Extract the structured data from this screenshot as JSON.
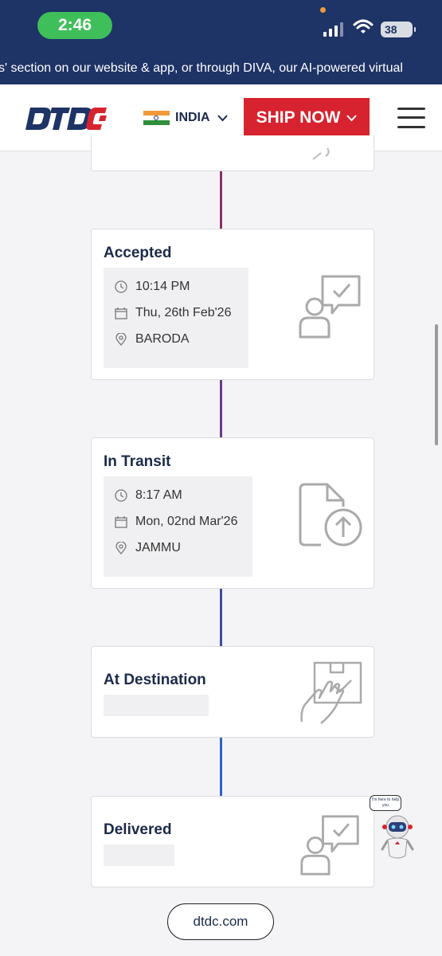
{
  "status_bar": {
    "time": "2:46",
    "battery": "38"
  },
  "announcement": "s' section on our website & app, or through DIVA, our AI-powered virtual",
  "header": {
    "logo_text": "DTDC",
    "country": "INDIA",
    "ship_now": "SHIP NOW",
    "colors": {
      "brand_red": "#d7232f",
      "brand_navy": "#1e3366"
    }
  },
  "timeline": [
    {
      "status": "Accepted",
      "time": "10:14 PM",
      "date": "Thu, 26th Feb'26",
      "location": "BARODA",
      "icon": "person-check-icon"
    },
    {
      "status": "In Transit",
      "time": "8:17 AM",
      "date": "Mon, 02nd Mar'26",
      "location": "JAMMU",
      "icon": "file-upload-icon"
    },
    {
      "status": "At Destination",
      "icon": "hand-package-icon"
    },
    {
      "status": "Delivered",
      "icon": "person-check-icon"
    }
  ],
  "chatbot": {
    "bubble": "I'm here to help you"
  },
  "footer": {
    "url": "dtdc.com"
  }
}
